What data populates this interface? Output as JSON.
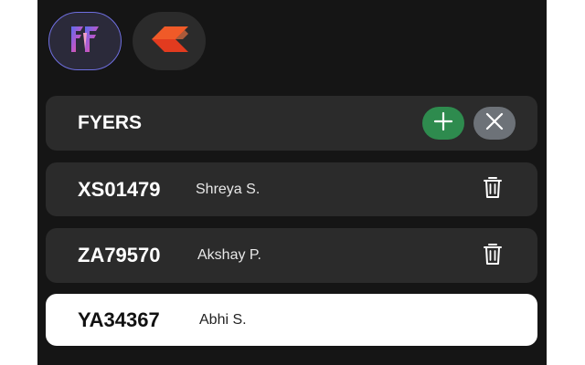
{
  "broker_tabs": [
    {
      "name": "fyers",
      "icon": "fyers-logo-icon",
      "selected": true
    },
    {
      "name": "kite",
      "icon": "kite-logo-icon",
      "selected": false
    }
  ],
  "broker_section": {
    "title": "FYERS",
    "add_icon": "plus-icon",
    "close_icon": "close-icon"
  },
  "accounts": [
    {
      "id": "XS01479",
      "name": "Shreya S.",
      "action_icon": "trash-icon",
      "selected": false
    },
    {
      "id": "ZA79570",
      "name": "Akshay P.",
      "action_icon": "trash-icon",
      "selected": false
    },
    {
      "id": "YA34367",
      "name": "Abhi S.",
      "selected": true
    }
  ],
  "colors": {
    "background": "#151515",
    "card": "#2b2b2b",
    "selected_card": "#ffffff",
    "add_button": "#2e8b4e",
    "close_button": "#6d7278",
    "fyers_accent": "#6f6fe0",
    "kite_accent": "#f05a28"
  }
}
